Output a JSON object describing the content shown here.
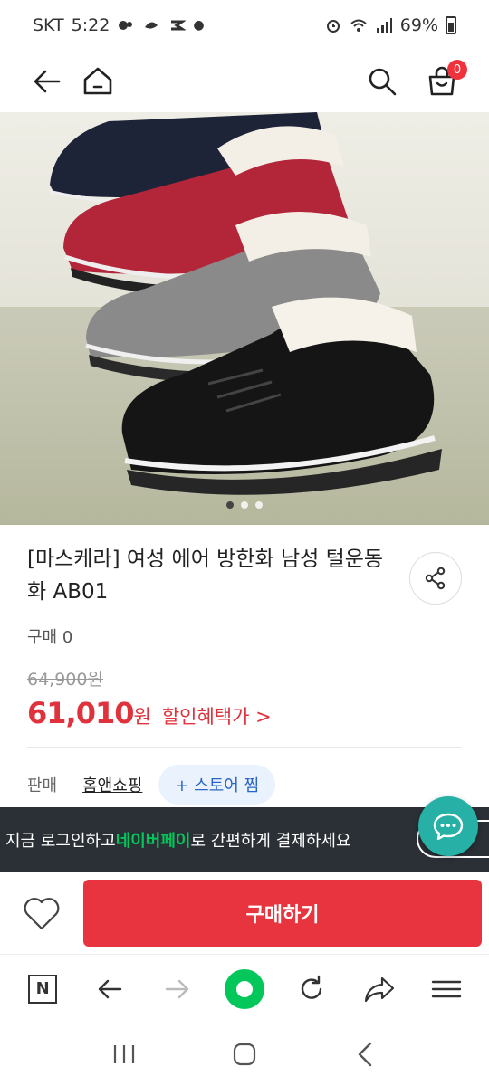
{
  "status_bar": {
    "carrier": "SKT",
    "time": "5:22",
    "battery": "69%"
  },
  "header": {
    "cart_count": "0"
  },
  "product": {
    "title": "[마스케라] 여성 에어 방한화 남성 털운동화 AB01",
    "purchase_count": "구매 0",
    "original_price": "64,900원",
    "sale_price": "61,010",
    "currency": "원",
    "discount_link": "할인혜택가 >",
    "carousel": {
      "total": 3,
      "active": 1
    }
  },
  "seller": {
    "label": "판매",
    "name": "홈앤쇼핑",
    "follow": "+ 스토어 찜"
  },
  "login_banner": {
    "pre": "지금 로그인하고 ",
    "highlight": "네이버페이",
    "post": "로 간편하게 결제하세요"
  },
  "buy_bar": {
    "buy_label": "구매하기"
  },
  "colors": {
    "accent_red": "#e8343f",
    "naver_green": "#03c75a",
    "chat_teal": "#27b0a6"
  },
  "toolbar": {
    "home_letter": "N"
  }
}
